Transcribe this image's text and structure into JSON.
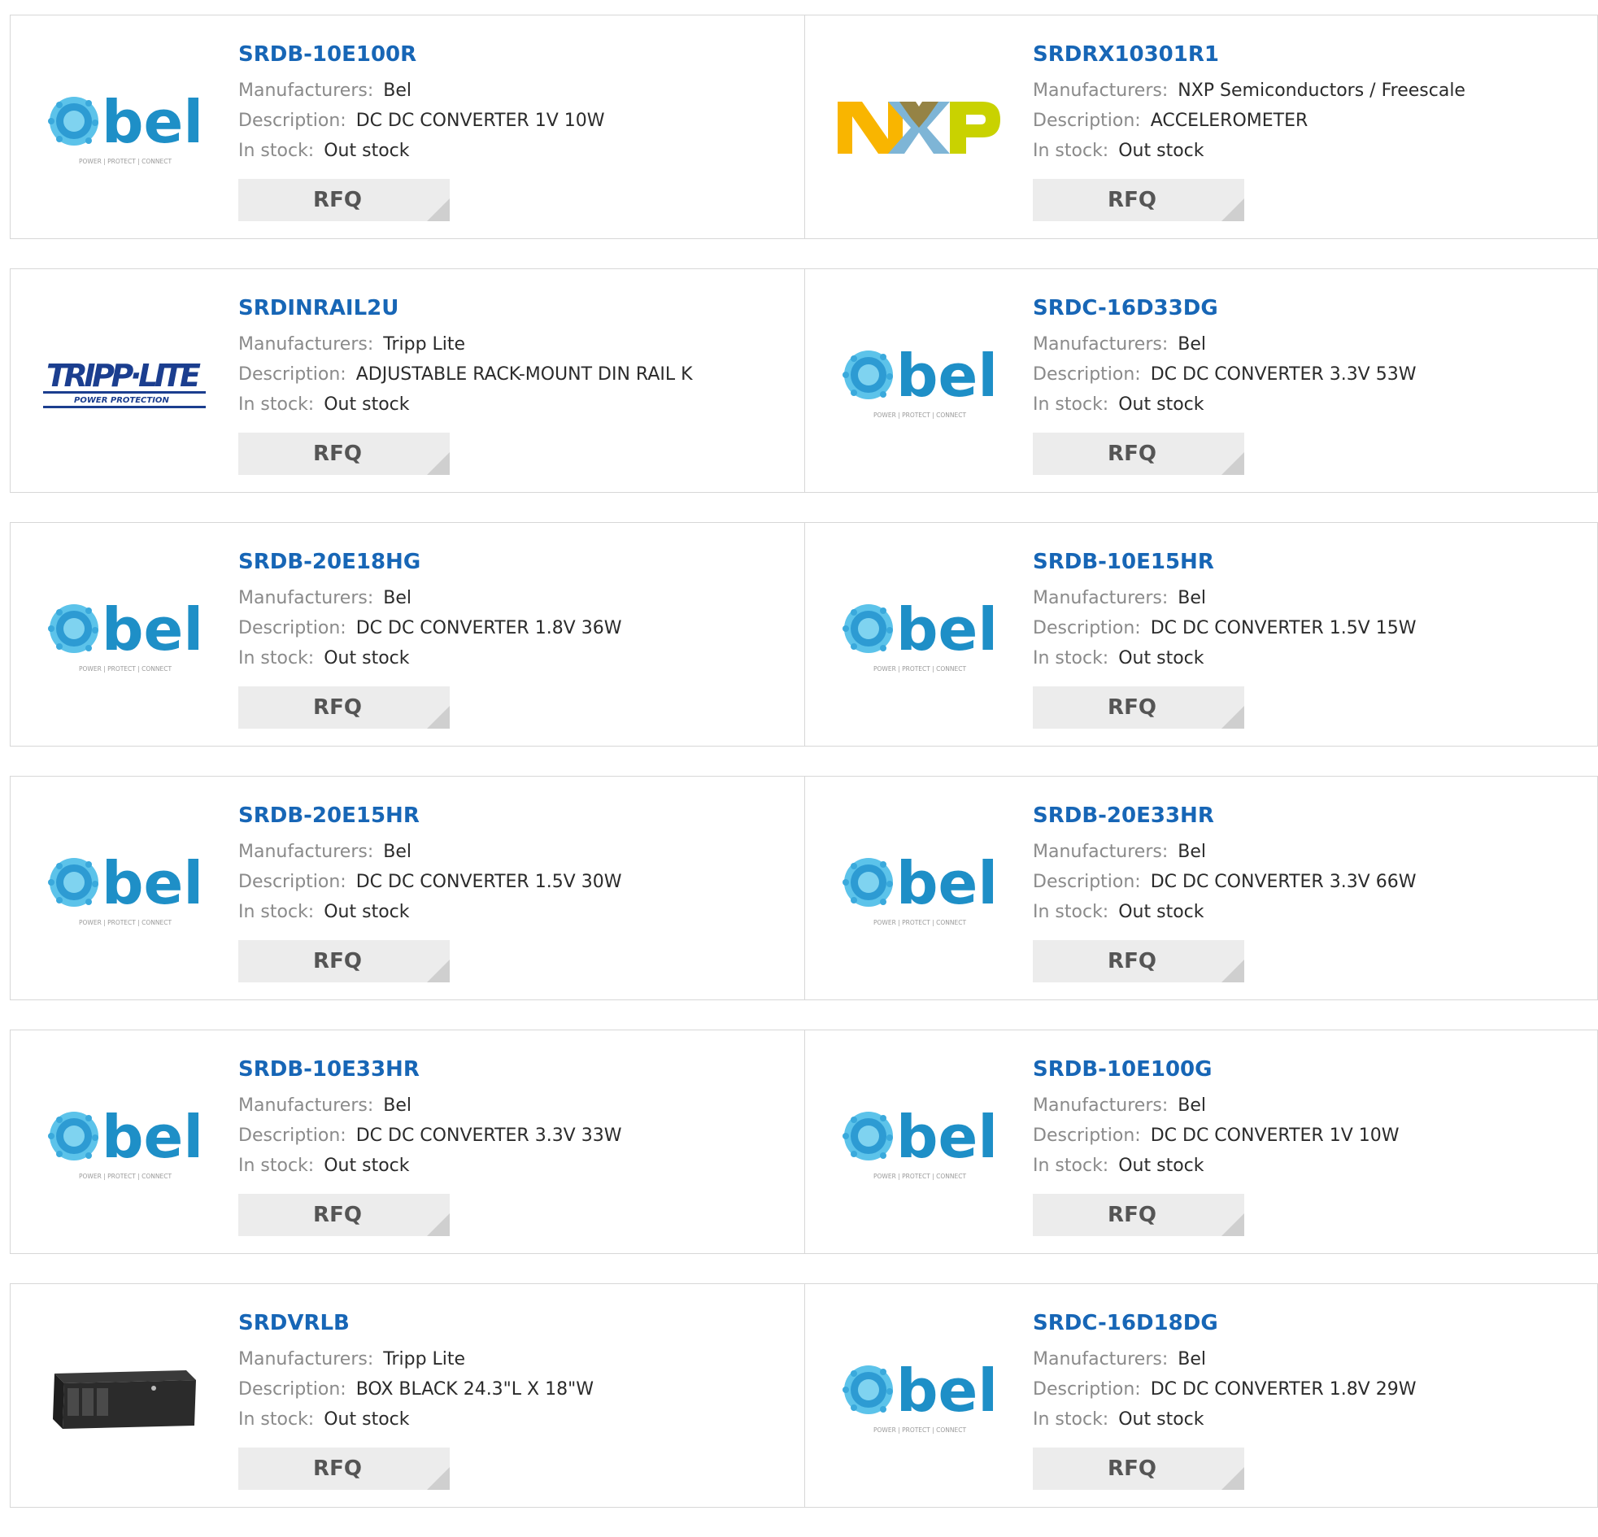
{
  "labels": {
    "manufacturers": "Manufacturers:",
    "description": "Description:",
    "stock": "In stock:",
    "rfq": "RFQ"
  },
  "products": [
    {
      "part": "SRDB-10E100R",
      "manufacturer": "Bel",
      "description": "DC DC CONVERTER 1V 10W",
      "stock": "Out stock",
      "logo": "bel-logo"
    },
    {
      "part": "SRDRX10301R1",
      "manufacturer": "NXP Semiconductors / Freescale",
      "description": "ACCELEROMETER",
      "stock": "Out stock",
      "logo": "nxp-logo"
    },
    {
      "part": "SRDINRAIL2U",
      "manufacturer": "Tripp Lite",
      "description": "ADJUSTABLE RACK-MOUNT DIN RAIL K",
      "stock": "Out stock",
      "logo": "tripplite-logo"
    },
    {
      "part": "SRDC-16D33DG",
      "manufacturer": "Bel",
      "description": "DC DC CONVERTER 3.3V 53W",
      "stock": "Out stock",
      "logo": "bel-logo"
    },
    {
      "part": "SRDB-20E18HG",
      "manufacturer": "Bel",
      "description": "DC DC CONVERTER 1.8V 36W",
      "stock": "Out stock",
      "logo": "bel-logo"
    },
    {
      "part": "SRDB-10E15HR",
      "manufacturer": "Bel",
      "description": "DC DC CONVERTER 1.5V 15W",
      "stock": "Out stock",
      "logo": "bel-logo"
    },
    {
      "part": "SRDB-20E15HR",
      "manufacturer": "Bel",
      "description": "DC DC CONVERTER 1.5V 30W",
      "stock": "Out stock",
      "logo": "bel-logo"
    },
    {
      "part": "SRDB-20E33HR",
      "manufacturer": "Bel",
      "description": "DC DC CONVERTER 3.3V 66W",
      "stock": "Out stock",
      "logo": "bel-logo"
    },
    {
      "part": "SRDB-10E33HR",
      "manufacturer": "Bel",
      "description": "DC DC CONVERTER 3.3V 33W",
      "stock": "Out stock",
      "logo": "bel-logo"
    },
    {
      "part": "SRDB-10E100G",
      "manufacturer": "Bel",
      "description": "DC DC CONVERTER 1V 10W",
      "stock": "Out stock",
      "logo": "bel-logo"
    },
    {
      "part": "SRDVRLB",
      "manufacturer": "Tripp Lite",
      "description": "BOX BLACK 24.3\"L X 18\"W",
      "stock": "Out stock",
      "logo": "black-box-product-image"
    },
    {
      "part": "SRDC-16D18DG",
      "manufacturer": "Bel",
      "description": "DC DC CONVERTER 1.8V 29W",
      "stock": "Out stock",
      "logo": "bel-logo"
    }
  ],
  "colors": {
    "part_link": "#1766b6",
    "label": "#8a8a8a",
    "value": "#2b2b2b",
    "rfq_bg": "#ececec",
    "border": "#d7d7d7",
    "bel_blue": "#1e8fc7",
    "bel_light": "#48c0e8"
  }
}
